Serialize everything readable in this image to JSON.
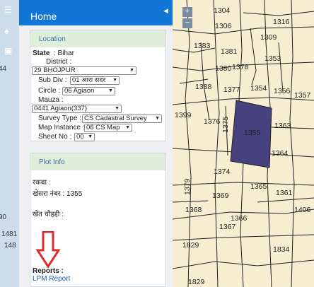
{
  "panel": {
    "title": "Home",
    "location": {
      "heading": "Location",
      "state_label": "State",
      "state_value": ": Bihar",
      "district_label": "District :",
      "district_value": "29 BHOJPUR",
      "subdiv_label": "Sub Div :",
      "subdiv_value": "01 आरा सदर",
      "circle_label": "Circle :",
      "circle_value": "06 Agiaon",
      "mauza_label": "Mauza :",
      "mauza_value": "0441 Agiaon(337)",
      "survey_type_label": "Survey Type :",
      "survey_type_value": "CS Cadastral Survey",
      "map_instance_label": "Map Instance :",
      "map_instance_value": "06 CS Map",
      "sheet_no_label": "Sheet No :",
      "sheet_no_value": "00"
    },
    "plot_info": {
      "heading": "Plot Info",
      "rakba": "रकबा :",
      "khesra": "खेसरा नंबर : 1355",
      "khet_chauhaddi": "खेत चौहद्दी :",
      "reports_label": "Reports :",
      "lpm_report_link": "LPM Report"
    }
  },
  "left_strip_numbers": [
    "44",
    "90",
    "1481",
    "148"
  ],
  "zoom": {
    "plus": "+",
    "minus": "−"
  },
  "map": {
    "selected_plot": "1355",
    "selected_color": "#47427f",
    "plot_numbers": [
      "1304",
      "1306",
      "1316",
      "1309",
      "1383",
      "1381",
      "1353",
      "1380",
      "1378",
      "1388",
      "1377",
      "1354",
      "1356",
      "1357",
      "1399",
      "1376",
      "1375",
      "1355",
      "1363",
      "1364",
      "1374",
      "1379",
      "1365",
      "1361",
      "1369",
      "1368",
      "1366",
      "1367",
      "1406",
      "1829",
      "1834",
      "1829"
    ]
  },
  "annotation": {
    "arrow_color": "#e22b2b"
  }
}
